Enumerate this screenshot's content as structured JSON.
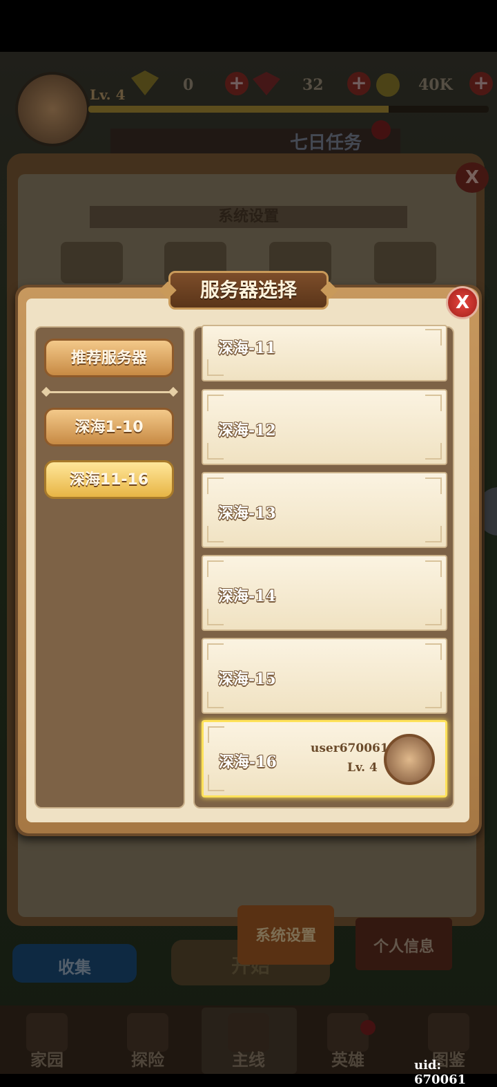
{
  "top": {
    "level": "Lv. 4",
    "diamonds": "0",
    "rubies": "32",
    "gold": "40K",
    "quest_banner": "七日任务",
    "xp_progress": 0.75
  },
  "settings_panel": {
    "title": "系统设置"
  },
  "modal": {
    "title": "服务器选择",
    "close": "X",
    "groups": [
      {
        "label": "推荐服务器"
      },
      {
        "label": "深海1-10"
      },
      {
        "label": "深海11-16"
      }
    ],
    "servers": [
      {
        "name": "深海-11"
      },
      {
        "name": "深海-12"
      },
      {
        "name": "深海-13"
      },
      {
        "name": "深海-14"
      },
      {
        "name": "深海-15"
      },
      {
        "name": "深海-16",
        "user": "user670061",
        "level": "Lv. 4"
      }
    ]
  },
  "bottom": {
    "tab_system": "系统设置",
    "tab_profile": "个人信息",
    "collect": "收集",
    "start": "开始",
    "nav": [
      "家园",
      "探险",
      "主线",
      "英雄",
      "图鉴"
    ],
    "uid": "uid: 670061"
  },
  "colors": {
    "accent_gold": "#ffe25a",
    "close_red": "#c6302a",
    "panel_brown": "#7d6246"
  }
}
